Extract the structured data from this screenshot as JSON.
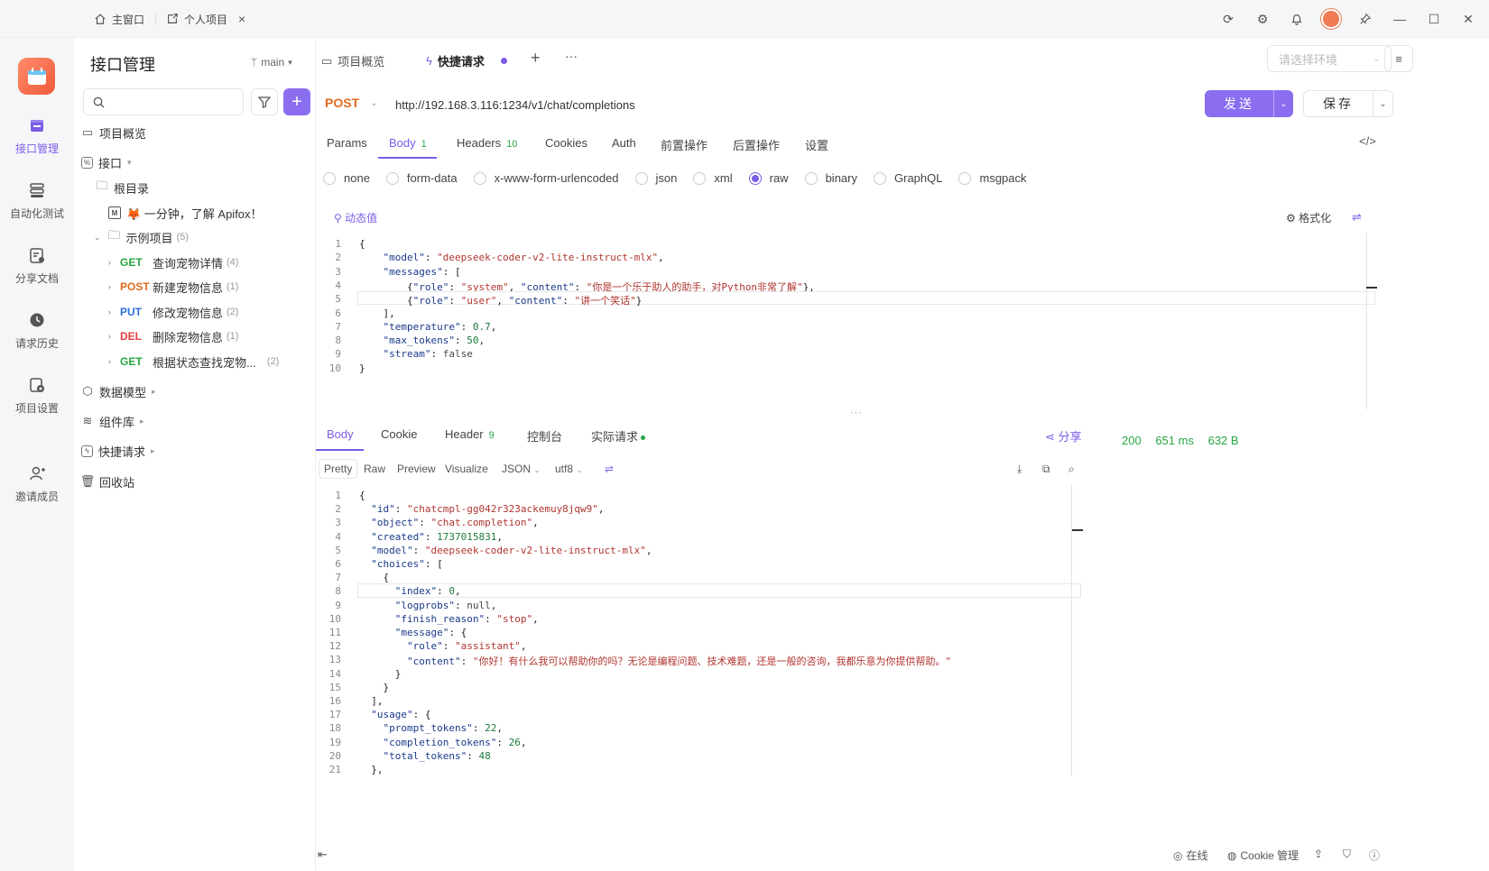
{
  "titlebar": {
    "tabs": [
      {
        "icon": "home-icon",
        "label": "主窗口"
      },
      {
        "icon": "external-link-icon",
        "label": "个人项目"
      }
    ],
    "close_glyph": "×",
    "icons": [
      "refresh-icon",
      "settings-icon",
      "bell-icon",
      "avatar",
      "pin-icon",
      "minimize-icon",
      "maximize-icon",
      "close-icon"
    ]
  },
  "rail": {
    "items": [
      {
        "label": "接口管理",
        "icon": "api-icon",
        "active": true
      },
      {
        "label": "自动化测试",
        "icon": "automation-icon"
      },
      {
        "label": "分享文档",
        "icon": "share-doc-icon"
      },
      {
        "label": "请求历史",
        "icon": "history-icon"
      },
      {
        "label": "项目设置",
        "icon": "project-settings-icon"
      },
      {
        "label": "邀请成员",
        "icon": "invite-member-icon"
      }
    ]
  },
  "left": {
    "title": "接口管理",
    "branch": "main",
    "search_placeholder": "",
    "add_glyph": "+",
    "overview": "项目概览",
    "interfaces": "接口",
    "root": "根目录",
    "intro": "🦊 一分钟，了解 Apifox！",
    "folder": {
      "label": "示例项目",
      "count": "(5)"
    },
    "endpoints": [
      {
        "method": "GET",
        "label": "查询宠物详情",
        "count": "(4)"
      },
      {
        "method": "POST",
        "label": "新建宠物信息",
        "count": "(1)"
      },
      {
        "method": "PUT",
        "label": "修改宠物信息",
        "count": "(2)"
      },
      {
        "method": "DEL",
        "label": "删除宠物信息",
        "count": "(1)"
      },
      {
        "method": "GET",
        "label": "根据状态查找宠物...",
        "count": "(2)"
      }
    ],
    "data_models": "数据模型",
    "components": "组件库",
    "quick_requests": "快捷请求",
    "recycle": "回收站"
  },
  "main": {
    "tabs": {
      "overview": "项目概览",
      "quick": "快捷请求",
      "add": "+",
      "more": "···"
    },
    "env_placeholder": "请选择环境",
    "method": "POST",
    "url": "http://192.168.3.116:1234/v1/chat/completions",
    "send": "发送",
    "save": "保存",
    "req_tabs": [
      {
        "label": "Params"
      },
      {
        "label": "Body",
        "count": "1",
        "active": true
      },
      {
        "label": "Headers",
        "count": "10"
      },
      {
        "label": "Cookies"
      },
      {
        "label": "Auth"
      },
      {
        "label": "前置操作"
      },
      {
        "label": "后置操作"
      },
      {
        "label": "设置"
      }
    ],
    "body_types": [
      {
        "label": "none"
      },
      {
        "label": "form-data"
      },
      {
        "label": "x-www-form-urlencoded"
      },
      {
        "label": "json"
      },
      {
        "label": "xml"
      },
      {
        "label": "raw",
        "selected": true
      },
      {
        "label": "binary"
      },
      {
        "label": "GraphQL"
      },
      {
        "label": "msgpack"
      }
    ],
    "dynamic_value": "动态值",
    "format": "格式化",
    "request_body": [
      "{",
      "    \"model\": \"deepseek-coder-v2-lite-instruct-mlx\",",
      "    \"messages\": [",
      "        {\"role\": \"system\", \"content\": \"你是一个乐于助人的助手，对Python非常了解\"},",
      "        {\"role\": \"user\", \"content\": \"讲一个笑话\"}",
      "    ],",
      "    \"temperature\": 0.7,",
      "    \"max_tokens\": 50,",
      "    \"stream\": false",
      "}"
    ],
    "resp_tabs": [
      {
        "label": "Body",
        "active": true
      },
      {
        "label": "Cookie"
      },
      {
        "label": "Header",
        "count": "9"
      },
      {
        "label": "控制台"
      },
      {
        "label": "实际请求"
      }
    ],
    "share": "分享",
    "status": {
      "code": "200",
      "time": "651 ms",
      "size": "632 B"
    },
    "resp_sub_tabs": [
      "Pretty",
      "Raw",
      "Preview",
      "Visualize",
      "JSON",
      "utf8"
    ],
    "response_body": [
      "{",
      "  \"id\": \"chatcmpl-gg042r323ackemuy8jqw9\",",
      "  \"object\": \"chat.completion\",",
      "  \"created\": 1737015831,",
      "  \"model\": \"deepseek-coder-v2-lite-instruct-mlx\",",
      "  \"choices\": [",
      "    {",
      "      \"index\": 0,",
      "      \"logprobs\": null,",
      "      \"finish_reason\": \"stop\",",
      "      \"message\": {",
      "        \"role\": \"assistant\",",
      "        \"content\": \"你好！有什么我可以帮助你的吗？无论是编程问题、技术难题，还是一般的咨询，我都乐意为你提供帮助。\"",
      "      }",
      "    }",
      "  ],",
      "  \"usage\": {",
      "    \"prompt_tokens\": 22,",
      "    \"completion_tokens\": 26,",
      "    \"total_tokens\": 48",
      "  },"
    ]
  },
  "bottombar": {
    "collapse": "⇤",
    "online": "在线",
    "cookie_mgr": "Cookie 管理"
  },
  "colors": {
    "accent": "#7c5ce8",
    "post": "#e36a1f",
    "get": "#27a644",
    "put": "#2e6fd8",
    "del": "#e34040"
  }
}
